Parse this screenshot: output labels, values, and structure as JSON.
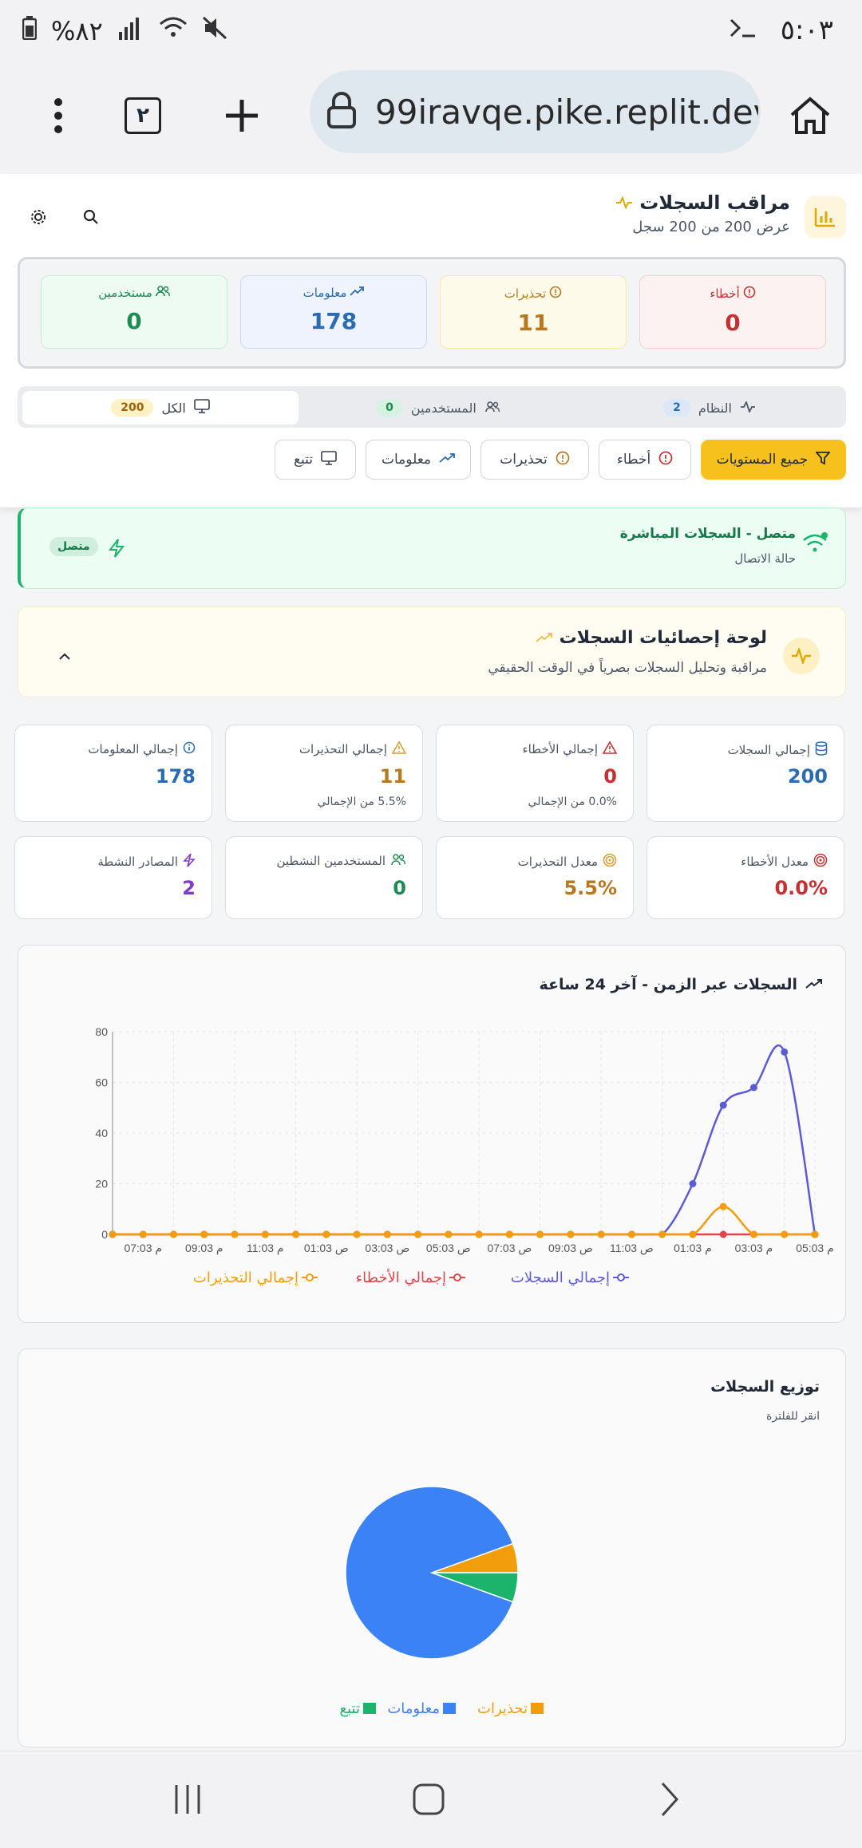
{
  "status_bar": {
    "battery": "%٨٢",
    "time": "٥:٠٣"
  },
  "browser": {
    "url": "99iravqe.pike.replit.dev",
    "tab_count": "٢"
  },
  "header": {
    "title": "مراقب السجلات",
    "subtitle": "عرض 200 من 200 سجل"
  },
  "level_counts": [
    {
      "label": "أخطاء",
      "value": "0",
      "color": "#c53030"
    },
    {
      "label": "تحذيرات",
      "value": "11",
      "color": "#b7791f"
    },
    {
      "label": "معلومات",
      "value": "178",
      "color": "#2b6cb0"
    },
    {
      "label": "مستخدمين",
      "value": "0",
      "color": "#1f8a52"
    }
  ],
  "tabs": [
    {
      "label": "النظام",
      "count": "2"
    },
    {
      "label": "المستخدمين",
      "count": "0"
    },
    {
      "label": "الكل",
      "count": "200"
    }
  ],
  "filters": [
    "جميع المستويات",
    "أخطاء",
    "تحذيرات",
    "معلومات",
    "تتبع"
  ],
  "connection": {
    "title": "متصل - السجلات المباشرة",
    "subtitle": "حالة الاتصال",
    "badge": "متصل"
  },
  "stats_panel": {
    "title": "لوحة إحصائيات السجلات",
    "subtitle": "مراقبة وتحليل السجلات بصرياً في الوقت الحقيقي"
  },
  "stats": [
    {
      "label": "إجمالي السجلات",
      "value": "200",
      "note": "",
      "color": "#2b6cb0"
    },
    {
      "label": "إجمالي الأخطاء",
      "value": "0",
      "note": "0.0% من الإجمالي",
      "color": "#c53030"
    },
    {
      "label": "إجمالي التحذيرات",
      "value": "11",
      "note": "5.5% من الإجمالي",
      "color": "#b7791f"
    },
    {
      "label": "إجمالي المعلومات",
      "value": "178",
      "note": "",
      "color": "#2b6cb0"
    },
    {
      "label": "معدل الأخطاء",
      "value": "0.0%",
      "note": "",
      "color": "#c53030"
    },
    {
      "label": "معدل التحذيرات",
      "value": "5.5%",
      "note": "",
      "color": "#b7791f"
    },
    {
      "label": "المستخدمين النشطين",
      "value": "0",
      "note": "",
      "color": "#1f8a52"
    },
    {
      "label": "المصادر النشطة",
      "value": "2",
      "note": "",
      "color": "#7e3ac9"
    }
  ],
  "line_chart_title": "السجلات عبر الزمن - آخر 24 ساعة",
  "pie_chart_title": "توزيع السجلات",
  "pie_chart_subtitle": "انقر للفلترة",
  "chart_data": [
    {
      "type": "line",
      "title": "السجلات عبر الزمن - آخر 24 ساعة",
      "x_tick_labels": [
        "07:03 م",
        "09:03 م",
        "11:03 م",
        "01:03 ص",
        "03:03 ص",
        "05:03 ص",
        "07:03 ص",
        "09:03 ص",
        "11:03 ص",
        "01:03 م",
        "03:03 م",
        "05:03 م"
      ],
      "ylim": [
        0,
        80
      ],
      "y_ticks": [
        0,
        20,
        40,
        60,
        80
      ],
      "series": [
        {
          "name": "إجمالي السجلات",
          "color": "#5b5bd6",
          "values": [
            0,
            0,
            0,
            0,
            0,
            0,
            0,
            0,
            0,
            0,
            0,
            0,
            0,
            0,
            0,
            0,
            0,
            0,
            0,
            20,
            51,
            58,
            72,
            0
          ]
        },
        {
          "name": "إجمالي الأخطاء",
          "color": "#e0454b",
          "values": [
            0,
            0,
            0,
            0,
            0,
            0,
            0,
            0,
            0,
            0,
            0,
            0,
            0,
            0,
            0,
            0,
            0,
            0,
            0,
            0,
            0,
            0,
            0,
            0
          ]
        },
        {
          "name": "إجمالي التحذيرات",
          "color": "#f29d0c",
          "values": [
            0,
            0,
            0,
            0,
            0,
            0,
            0,
            0,
            0,
            0,
            0,
            0,
            0,
            0,
            0,
            0,
            0,
            0,
            0,
            0,
            11,
            0,
            0,
            0
          ]
        }
      ],
      "grid": true,
      "legend": "bottom"
    },
    {
      "type": "pie",
      "title": "توزيع السجلات",
      "slices": [
        {
          "name": "تحذيرات",
          "value": 11,
          "color": "#f29d0c"
        },
        {
          "name": "معلومات",
          "value": 178,
          "color": "#3b82f6"
        },
        {
          "name": "تتبع",
          "value": 11,
          "color": "#1cb36b"
        }
      ],
      "legend": "bottom"
    }
  ]
}
